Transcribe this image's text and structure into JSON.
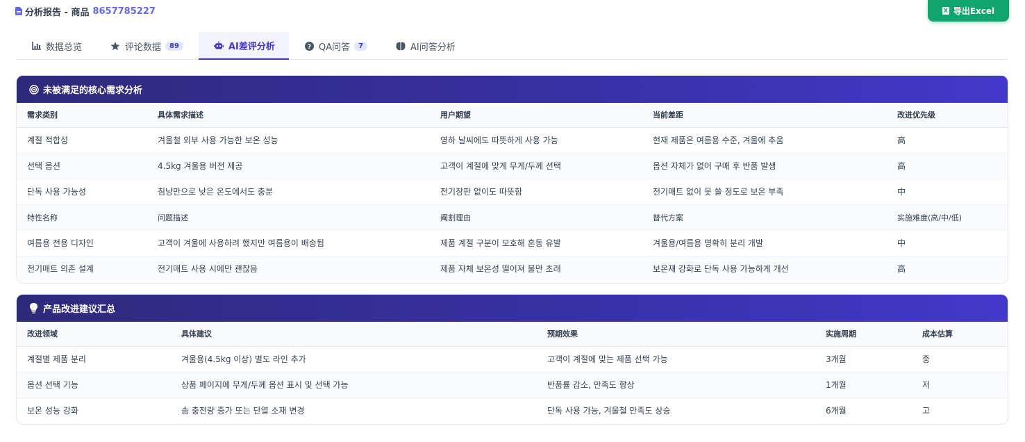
{
  "header": {
    "title": "分析报告 - 商品",
    "product_id": "8657785227",
    "export_label": "导出Excel"
  },
  "tabs": [
    {
      "label": "数据总览",
      "icon": "bar-chart-icon"
    },
    {
      "label": "评论数据",
      "icon": "star-icon",
      "badge": "89"
    },
    {
      "label": "AI差评分析",
      "icon": "robot-icon",
      "active": true
    },
    {
      "label": "QA问答",
      "icon": "question-circle-icon",
      "badge": "7"
    },
    {
      "label": "AI问答分析",
      "icon": "brain-icon"
    }
  ],
  "needs": {
    "title": "未被满足的核心需求分析",
    "icon": "target-icon",
    "columns": [
      "需求类别",
      "具体需求描述",
      "用户期望",
      "当前差距",
      "改进优先级"
    ],
    "rows": [
      [
        "계절 적합성",
        "겨울철 외부 사용 가능한 보온 성능",
        "영하 날씨에도 따뜻하게 사용 가능",
        "현재 제품은 여름용 수준, 겨울에 추움",
        "高"
      ],
      [
        "선택 옵션",
        "4.5kg 겨울용 버전 제공",
        "고객이 계절에 맞게 무게/두께 선택",
        "옵션 자체가 없어 구매 후 반품 발생",
        "高"
      ],
      [
        "단독 사용 가능성",
        "침낭만으로 낮은 온도에서도 충분",
        "전기장판 없이도 따뜻함",
        "전기매트 없이 못 쓸 정도로 보온 부족",
        "中"
      ]
    ],
    "subheader": [
      "特性名称",
      "问题描述",
      "阉割理由",
      "替代方案",
      "实施难度(高/中/低)"
    ],
    "rows2": [
      [
        "여름용 전용 디자인",
        "고객이 겨울에 사용하려 했지만 여름용이 배송됨",
        "제품 계절 구분이 모호해 혼동 유발",
        "겨울용/여름용 명확히 분리 개발",
        "中"
      ],
      [
        "전기매트 의존 설계",
        "전기매트 사용 시에만 괜찮음",
        "제품 자체 보온성 떨어져 불만 초래",
        "보온재 강화로 단독 사용 가능하게 개선",
        "高"
      ]
    ]
  },
  "suggestions": {
    "title": "产品改进建议汇总",
    "icon": "lightbulb-icon",
    "columns": [
      "改进领域",
      "具体建议",
      "预期效果",
      "实施周期",
      "成本估算"
    ],
    "rows": [
      [
        "계절별 제품 분리",
        "겨울용(4.5kg 이상) 별도 라인 추가",
        "고객이 계절에 맞는 제품 선택 가능",
        "3개월",
        "중"
      ],
      [
        "옵션 선택 기능",
        "상품 페이지에 무게/두께 옵션 표시 및 선택 가능",
        "반품률 감소, 만족도 향상",
        "1개월",
        "저"
      ],
      [
        "보온 성능 강화",
        "솜 충전량 증가 또는 단열 소재 변경",
        "단독 사용 가능, 겨울철 만족도 상승",
        "6개월",
        "고"
      ]
    ]
  },
  "colors": {
    "accent": "#4338ca",
    "export_green": "#10a56e",
    "header_gradient_start": "#2e2a7a",
    "header_gradient_end": "#4338ca"
  }
}
